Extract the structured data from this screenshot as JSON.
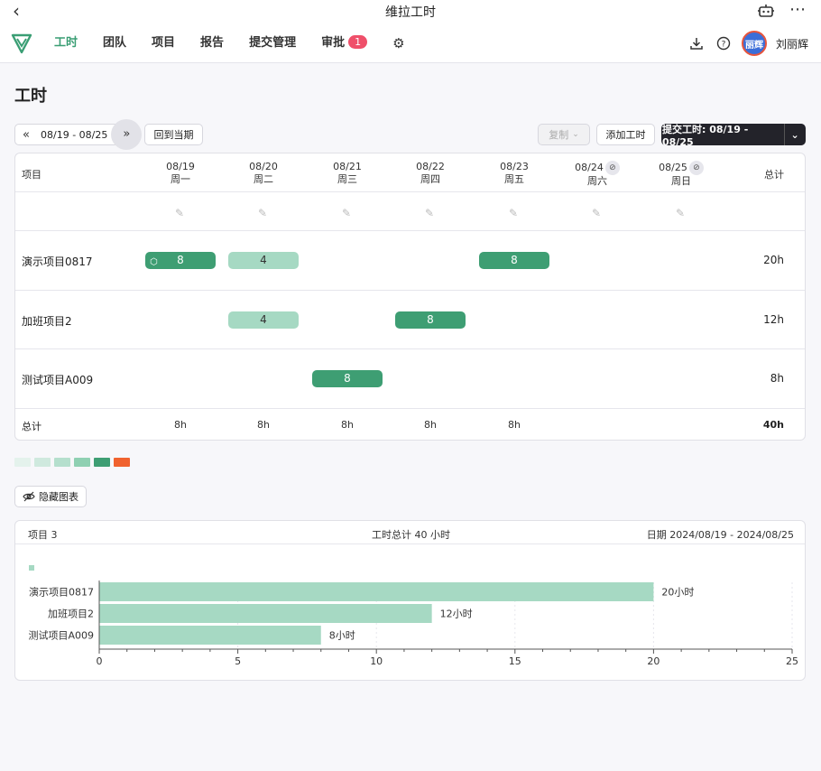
{
  "window": {
    "title": "维拉工时"
  },
  "nav": {
    "items": [
      {
        "label": "工时",
        "active": true
      },
      {
        "label": "团队"
      },
      {
        "label": "项目"
      },
      {
        "label": "报告"
      },
      {
        "label": "提交管理"
      },
      {
        "label": "审批",
        "badge": "1"
      }
    ],
    "user": {
      "avatar_text": "丽辉",
      "name": "刘丽辉"
    }
  },
  "page": {
    "title": "工时"
  },
  "toolbar": {
    "date_range": "08/19 - 08/25",
    "back_to_current": "回到当期",
    "copy": "复制",
    "add_hours": "添加工时",
    "submit": "提交工时: 08/19 - 08/25"
  },
  "grid": {
    "project_header": "项目",
    "total_header": "总计",
    "days": [
      {
        "date": "08/19",
        "weekday": "周一"
      },
      {
        "date": "08/20",
        "weekday": "周二"
      },
      {
        "date": "08/21",
        "weekday": "周三"
      },
      {
        "date": "08/22",
        "weekday": "周四"
      },
      {
        "date": "08/23",
        "weekday": "周五"
      },
      {
        "date": "08/24",
        "weekday": "周六",
        "hidden": true
      },
      {
        "date": "08/25",
        "weekday": "周日",
        "hidden": true
      }
    ],
    "rows": [
      {
        "name": "演示项目0817",
        "cells": [
          "8",
          "4",
          "",
          "",
          "8",
          "",
          ""
        ],
        "shade": [
          "dark",
          "light",
          "",
          "",
          "dark",
          "",
          ""
        ],
        "total": "20h"
      },
      {
        "name": "加班项目2",
        "cells": [
          "",
          "4",
          "",
          "8",
          "",
          "",
          ""
        ],
        "shade": [
          "",
          "light",
          "",
          "dark",
          "",
          "",
          ""
        ],
        "total": "12h"
      },
      {
        "name": "测试项目A009",
        "cells": [
          "",
          "",
          "8",
          "",
          "",
          "",
          ""
        ],
        "shade": [
          "",
          "",
          "dark",
          "",
          "",
          "",
          ""
        ],
        "total": "8h"
      }
    ],
    "totals_label": "总计",
    "day_totals": [
      "8h",
      "8h",
      "8h",
      "8h",
      "8h",
      "",
      ""
    ],
    "grand_total": "40h"
  },
  "legend_colors": [
    "#e4f2ec",
    "#cfe9de",
    "#b5dfcd",
    "#8fd0b2",
    "#3e9e73",
    "#f0622e"
  ],
  "chart_toggle": "隐藏图表",
  "chart_card": {
    "left_label": "项目 3",
    "center_label": "工时总计 40 小时",
    "right_label": "日期 2024/08/19 - 2024/08/25"
  },
  "chart_data": {
    "type": "bar",
    "orientation": "horizontal",
    "categories": [
      "演示项目0817",
      "加班项目2",
      "测试项目A009"
    ],
    "values": [
      20,
      12,
      8
    ],
    "value_labels": [
      "20小时",
      "12小时",
      "8小时"
    ],
    "xlim": [
      0,
      25
    ],
    "xticks": [
      0,
      5,
      10,
      15,
      20,
      25
    ],
    "bar_color": "#a6d9c3"
  }
}
